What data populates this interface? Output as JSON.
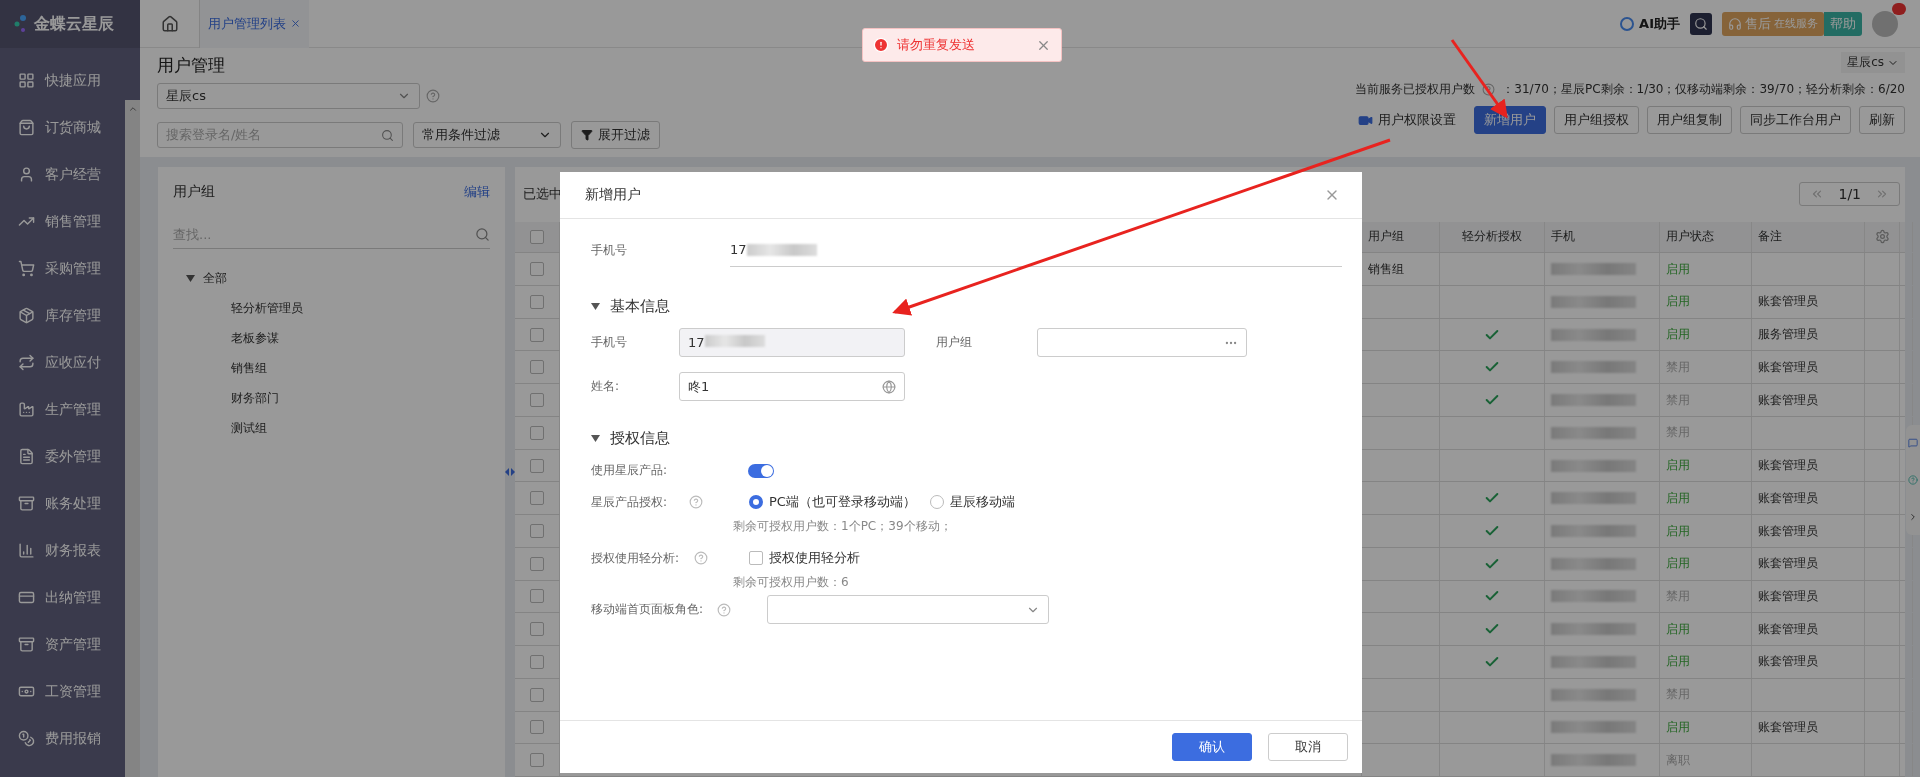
{
  "app": {
    "logo": "金蝶云星辰"
  },
  "sidebar": {
    "items": [
      "快捷应用",
      "订货商城",
      "客户经营",
      "销售管理",
      "采购管理",
      "库存管理",
      "应收应付",
      "生产管理",
      "委外管理",
      "账务处理",
      "财务报表",
      "出纳管理",
      "资产管理",
      "工资管理",
      "费用报销"
    ]
  },
  "tabs": [
    {
      "label": "用户管理列表",
      "selected": true
    }
  ],
  "top_right": {
    "ai": "AI助手",
    "service": "售后",
    "service_sub": "在线服务",
    "help": "帮助"
  },
  "toast": {
    "message": "请勿重复发送"
  },
  "page": {
    "title": "用户管理",
    "account_select": "星辰cs",
    "search_placeholder": "搜索登录名/姓名",
    "filter_select": "常用条件过滤",
    "expand_filter": "展开过滤",
    "account_menu": "星辰cs",
    "stats_label": "当前服务已授权用户数",
    "stats_values": "：31/70；星辰PC剩余：1/30；仅移动端剩余：39/70；轻分析剩余：6/20"
  },
  "toolbar": [
    {
      "label": "用户权限设置",
      "kind": "link"
    },
    {
      "label": "新增用户",
      "kind": "primary"
    },
    {
      "label": "用户组授权",
      "kind": "default"
    },
    {
      "label": "用户组复制",
      "kind": "default"
    },
    {
      "label": "同步工作台用户",
      "kind": "default"
    },
    {
      "label": "刷新",
      "kind": "default"
    }
  ],
  "group_panel": {
    "title": "用户组",
    "edit": "编辑",
    "search_placeholder": "查找...",
    "tree": [
      {
        "label": "全部",
        "expanded": true,
        "children": [
          {
            "label": "轻分析管理员"
          },
          {
            "label": "老板参谋"
          },
          {
            "label": "销售组"
          },
          {
            "label": "财务部门"
          },
          {
            "label": "测试组"
          }
        ]
      }
    ]
  },
  "table": {
    "selected_info": "已选中",
    "pagination": "1/1",
    "all_checked": false,
    "columns": [
      "用户组",
      "轻分析授权",
      "手机",
      "用户状态",
      "备注"
    ],
    "rows": [
      {
        "checked": false,
        "group": "销售组",
        "light_auth": false,
        "status": "启用",
        "active": true
      },
      {
        "checked": false,
        "light_auth": false,
        "status": "启用",
        "active": true,
        "note": "账套管理员"
      },
      {
        "checked": false,
        "light_auth": true,
        "status": "启用",
        "active": true,
        "note": "服务管理员"
      },
      {
        "checked": false,
        "light_auth": true,
        "status": "禁用",
        "active": false,
        "note": "账套管理员"
      },
      {
        "checked": false,
        "light_auth": true,
        "status": "禁用",
        "active": false,
        "note": "账套管理员"
      },
      {
        "checked": false,
        "light_auth": false,
        "status": "禁用",
        "active": false
      },
      {
        "checked": false,
        "light_auth": false,
        "status": "启用",
        "active": true,
        "note": "账套管理员"
      },
      {
        "checked": false,
        "light_auth": true,
        "status": "启用",
        "active": true,
        "note": "账套管理员"
      },
      {
        "checked": false,
        "light_auth": true,
        "status": "启用",
        "active": true,
        "note": "账套管理员"
      },
      {
        "checked": false,
        "light_auth": true,
        "status": "启用",
        "active": true,
        "note": "账套管理员"
      },
      {
        "checked": false,
        "light_auth": true,
        "status": "禁用",
        "active": false,
        "note": "账套管理员"
      },
      {
        "checked": false,
        "light_auth": true,
        "status": "启用",
        "active": true,
        "note": "账套管理员"
      },
      {
        "checked": false,
        "light_auth": true,
        "status": "启用",
        "active": true,
        "note": "账套管理员"
      },
      {
        "checked": false,
        "light_auth": false,
        "status": "禁用",
        "active": false
      },
      {
        "checked": false,
        "light_auth": false,
        "status": "启用",
        "active": true,
        "note": "账套管理员"
      },
      {
        "checked": false,
        "light_auth": false,
        "status": "离职",
        "active": false
      }
    ]
  },
  "dialog": {
    "title": "新增用户",
    "phone_label": "手机号",
    "phone_value": "17",
    "basic_section": {
      "title": "基本信息",
      "expanded": true,
      "phone_label": "手机号",
      "phone_value": "17",
      "group_label": "用户组",
      "name_label": "姓名:",
      "name_value": "咚1"
    },
    "auth_section": {
      "title": "授权信息",
      "expanded": true,
      "use_product": {
        "label": "使用星辰产品:",
        "on": true
      },
      "product_auth": {
        "label": "星辰产品授权:",
        "options": [
          {
            "label": "PC端（也可登录移动端）",
            "selected": true
          },
          {
            "label": "星辰移动端",
            "selected": false
          }
        ],
        "hint": "剩余可授权用户数：1个PC；39个移动；"
      },
      "light_analysis": {
        "label": "授权使用轻分析:",
        "checkbox_label": "授权使用轻分析",
        "checked": false,
        "hint": "剩余可授权用户数：6"
      },
      "mobile_role": {
        "label": "移动端首页面板角色:"
      }
    },
    "confirm": "确认",
    "cancel": "取消"
  }
}
